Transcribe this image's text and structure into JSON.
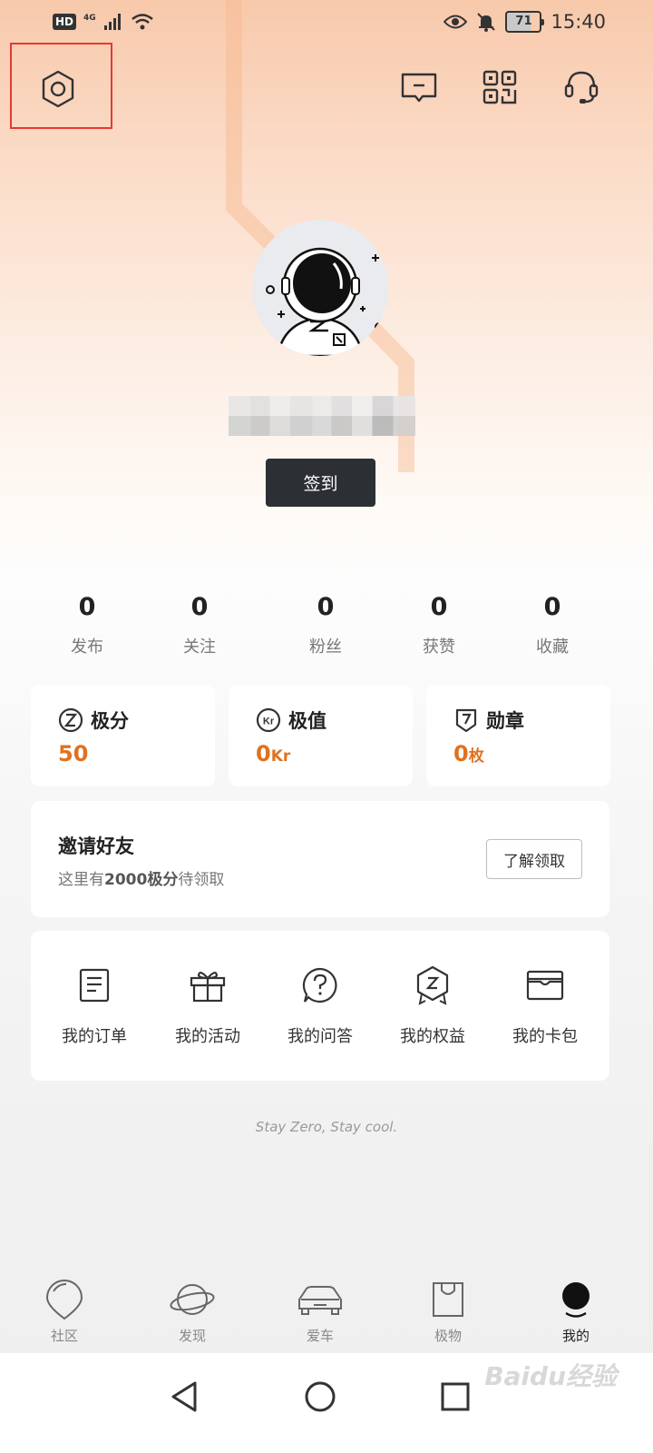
{
  "status_bar": {
    "hd": "HD",
    "network": "4G",
    "battery": "71",
    "time": "15:40"
  },
  "header": {
    "settings_icon": "hexagon-settings-icon",
    "message_icon": "message-icon",
    "qr_icon": "qr-code-icon",
    "support_icon": "headset-icon",
    "highlight_color": "#e53935"
  },
  "profile": {
    "checkin_label": "签到"
  },
  "stats": [
    {
      "value": "0",
      "label": "发布"
    },
    {
      "value": "0",
      "label": "关注"
    },
    {
      "value": "0",
      "label": "粉丝"
    },
    {
      "value": "0",
      "label": "获赞"
    },
    {
      "value": "0",
      "label": "收藏"
    }
  ],
  "metrics": [
    {
      "title": "极分",
      "value": "50",
      "unit": "",
      "icon": "z-coin-icon"
    },
    {
      "title": "极值",
      "value": "0",
      "unit": "Kr",
      "icon": "kr-coin-icon"
    },
    {
      "title": "勋章",
      "value": "0",
      "unit": "枚",
      "icon": "medal-icon"
    }
  ],
  "accent_color": "#e0711f",
  "invite": {
    "title": "邀请好友",
    "desc_prefix": "这里有",
    "desc_highlight": "2000极分",
    "desc_suffix": "待领取",
    "button": "了解领取"
  },
  "menu": [
    {
      "label": "我的订单",
      "icon": "order-icon"
    },
    {
      "label": "我的活动",
      "icon": "gift-icon"
    },
    {
      "label": "我的问答",
      "icon": "question-icon"
    },
    {
      "label": "我的权益",
      "icon": "benefit-badge-icon"
    },
    {
      "label": "我的卡包",
      "icon": "card-wallet-icon"
    }
  ],
  "slogan": "Stay Zero, Stay cool.",
  "tabs": [
    {
      "label": "社区",
      "icon": "community-icon",
      "active": false
    },
    {
      "label": "发现",
      "icon": "planet-icon",
      "active": false
    },
    {
      "label": "爱车",
      "icon": "car-icon",
      "active": false
    },
    {
      "label": "极物",
      "icon": "shopping-bag-icon",
      "active": false
    },
    {
      "label": "我的",
      "icon": "profile-icon",
      "active": true
    }
  ],
  "watermark": "Baidu经验"
}
